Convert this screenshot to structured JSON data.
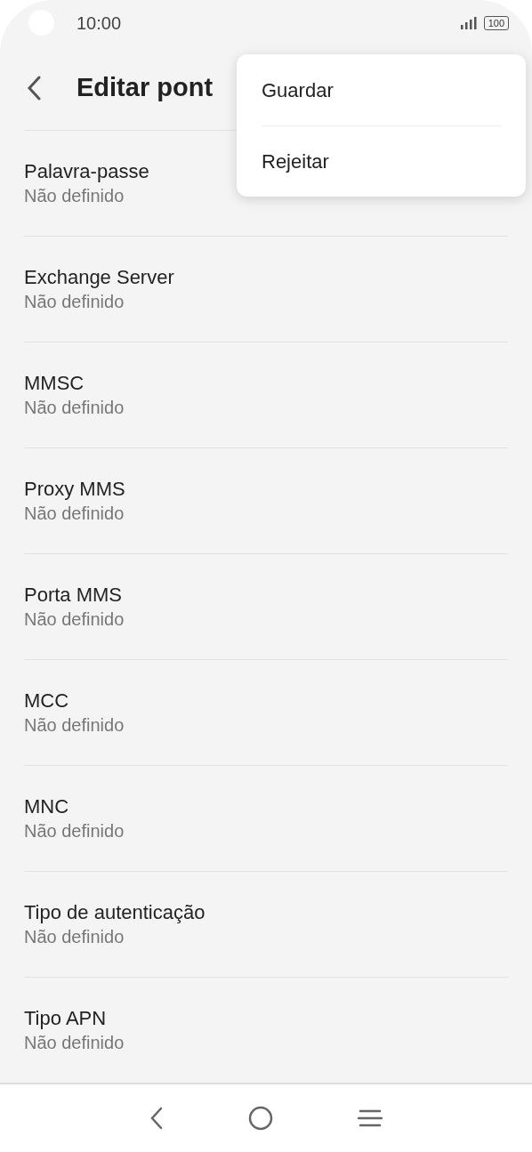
{
  "status_bar": {
    "time": "10:00",
    "battery": "100"
  },
  "header": {
    "title": "Editar pont"
  },
  "menu": {
    "items": [
      {
        "label": "Guardar"
      },
      {
        "label": "Rejeitar"
      }
    ]
  },
  "settings": [
    {
      "title": "Palavra-passe",
      "value": "Não definido"
    },
    {
      "title": "Exchange Server",
      "value": "Não definido"
    },
    {
      "title": "MMSC",
      "value": "Não definido"
    },
    {
      "title": "Proxy MMS",
      "value": "Não definido"
    },
    {
      "title": "Porta MMS",
      "value": "Não definido"
    },
    {
      "title": "MCC",
      "value": "Não definido"
    },
    {
      "title": "MNC",
      "value": "Não definido"
    },
    {
      "title": "Tipo de autenticação",
      "value": "Não definido"
    },
    {
      "title": "Tipo APN",
      "value": "Não definido"
    }
  ]
}
